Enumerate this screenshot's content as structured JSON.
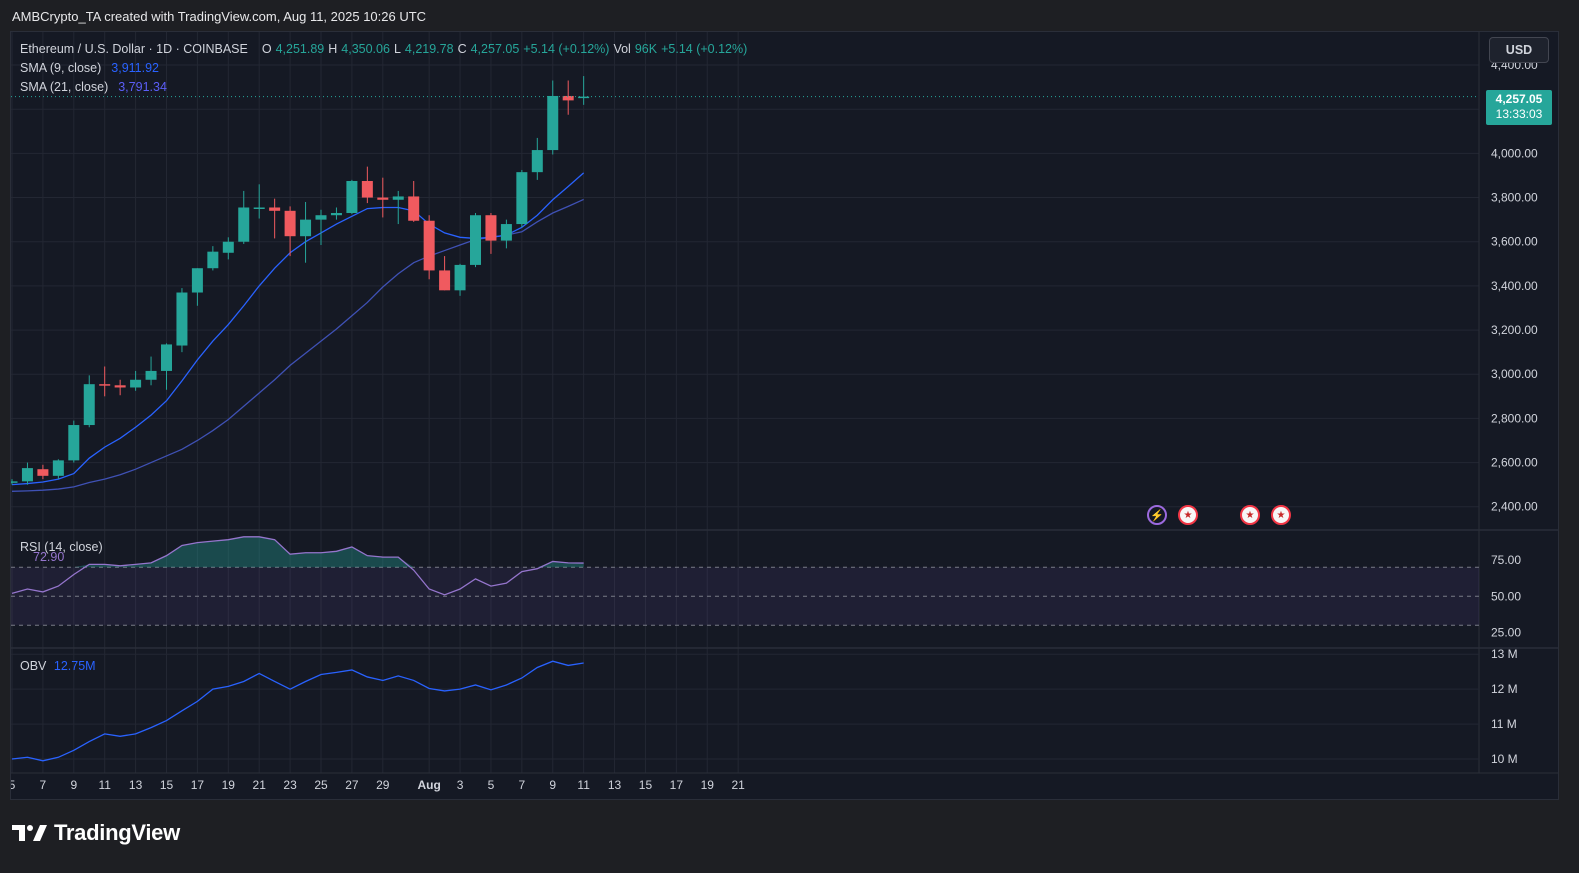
{
  "caption": "AMBCrypto_TA created with TradingView.com, Aug 11, 2025 10:26 UTC",
  "header": {
    "symbol": "Ethereum / U.S. Dollar · 1D · COINBASE",
    "o_label": "O",
    "o_value": "4,251.89",
    "h_label": "H",
    "h_value": "4,350.06",
    "l_label": "L",
    "l_value": "4,219.78",
    "c_label": "C",
    "c_value": "4,257.05",
    "change": "+5.14 (+0.12%)",
    "vol_label": "Vol",
    "vol_value": "96K",
    "vol_change": "+5.14 (+0.12%)"
  },
  "indicators": {
    "sma9_label": "SMA (9, close)",
    "sma9_value": "3,911.92",
    "sma21_label": "SMA (21, close)",
    "sma21_value": "3,791.34",
    "rsi_label": "RSI (14, close)",
    "rsi_value": "72.90",
    "obv_label": "OBV",
    "obv_value": "12.75M"
  },
  "toolbar": {
    "currency_label": "USD"
  },
  "last_price": {
    "price": "4,257.05",
    "countdown": "13:33:03"
  },
  "brand": {
    "name": "TradingView"
  },
  "colors": {
    "up": "#26a69a",
    "down": "#f05a5f",
    "sma9": "#2962ff",
    "sma21": "#3f51b5",
    "rsi": "#9575cd",
    "obv": "#2962ff",
    "background": "#151924",
    "grid": "#232733"
  },
  "icons": [
    "lightning-event-icon",
    "us-flag-event-icon",
    "us-flag-event-icon",
    "us-flag-event-icon"
  ],
  "chart_data": [
    {
      "type": "candlestick",
      "title": "Ethereum / U.S. Dollar · 1D · COINBASE",
      "x_tick_labels": [
        "5",
        "7",
        "9",
        "11",
        "13",
        "15",
        "17",
        "19",
        "21",
        "23",
        "25",
        "27",
        "29",
        "Aug",
        "3",
        "5",
        "7",
        "9",
        "11",
        "13",
        "15",
        "17",
        "19",
        "21"
      ],
      "y_tick_labels": [
        "4,400.00",
        "4,200.00",
        "4,000.00",
        "3,800.00",
        "3,600.00",
        "3,400.00",
        "3,200.00",
        "3,000.00",
        "2,800.00",
        "2,600.00",
        "2,400.00"
      ],
      "ylim": [
        2340,
        4450
      ],
      "grid": true,
      "dates": [
        "Jul 5",
        "Jul 6",
        "Jul 7",
        "Jul 8",
        "Jul 9",
        "Jul 10",
        "Jul 11",
        "Jul 12",
        "Jul 13",
        "Jul 14",
        "Jul 15",
        "Jul 16",
        "Jul 17",
        "Jul 18",
        "Jul 19",
        "Jul 20",
        "Jul 21",
        "Jul 22",
        "Jul 23",
        "Jul 24",
        "Jul 25",
        "Jul 26",
        "Jul 27",
        "Jul 28",
        "Jul 29",
        "Jul 30",
        "Jul 31",
        "Aug 1",
        "Aug 2",
        "Aug 3",
        "Aug 4",
        "Aug 5",
        "Aug 6",
        "Aug 7",
        "Aug 8",
        "Aug 9",
        "Aug 10",
        "Aug 11"
      ],
      "ohlc": [
        [
          2510,
          2525,
          2500,
          2515
        ],
        [
          2515,
          2600,
          2500,
          2575
        ],
        [
          2570,
          2590,
          2525,
          2540
        ],
        [
          2540,
          2615,
          2525,
          2610
        ],
        [
          2610,
          2790,
          2600,
          2770
        ],
        [
          2770,
          2995,
          2760,
          2955
        ],
        [
          2955,
          3035,
          2900,
          2950
        ],
        [
          2950,
          2975,
          2905,
          2940
        ],
        [
          2940,
          3015,
          2925,
          2975
        ],
        [
          2975,
          3080,
          2950,
          3015
        ],
        [
          3015,
          3140,
          2930,
          3135
        ],
        [
          3130,
          3390,
          3100,
          3370
        ],
        [
          3370,
          3480,
          3310,
          3480
        ],
        [
          3480,
          3580,
          3470,
          3555
        ],
        [
          3550,
          3620,
          3520,
          3600
        ],
        [
          3600,
          3830,
          3590,
          3755
        ],
        [
          3755,
          3860,
          3705,
          3755
        ],
        [
          3755,
          3795,
          3615,
          3740
        ],
        [
          3740,
          3760,
          3535,
          3625
        ],
        [
          3625,
          3780,
          3505,
          3700
        ],
        [
          3700,
          3745,
          3585,
          3720
        ],
        [
          3720,
          3755,
          3700,
          3730
        ],
        [
          3730,
          3880,
          3725,
          3875
        ],
        [
          3875,
          3940,
          3775,
          3800
        ],
        [
          3800,
          3890,
          3710,
          3790
        ],
        [
          3790,
          3830,
          3680,
          3805
        ],
        [
          3805,
          3875,
          3690,
          3695
        ],
        [
          3695,
          3720,
          3430,
          3470
        ],
        [
          3470,
          3535,
          3380,
          3380
        ],
        [
          3380,
          3500,
          3355,
          3495
        ],
        [
          3495,
          3730,
          3485,
          3720
        ],
        [
          3720,
          3730,
          3545,
          3605
        ],
        [
          3605,
          3700,
          3570,
          3680
        ],
        [
          3680,
          3925,
          3665,
          3915
        ],
        [
          3915,
          4070,
          3880,
          4015
        ],
        [
          4015,
          4330,
          3995,
          4260
        ],
        [
          4260,
          4330,
          4175,
          4240
        ],
        [
          4251.89,
          4350.06,
          4219.78,
          4257.05
        ]
      ],
      "series": [
        {
          "name": "SMA (9, close)",
          "values": [
            2500,
            2505,
            2512,
            2525,
            2550,
            2620,
            2670,
            2710,
            2760,
            2815,
            2880,
            2970,
            3065,
            3150,
            3225,
            3310,
            3400,
            3480,
            3550,
            3600,
            3640,
            3680,
            3715,
            3750,
            3755,
            3755,
            3740,
            3680,
            3640,
            3620,
            3615,
            3620,
            3630,
            3665,
            3720,
            3790,
            3850,
            3911.92
          ]
        },
        {
          "name": "SMA (21, close)",
          "values": [
            2470,
            2472,
            2475,
            2480,
            2490,
            2510,
            2525,
            2545,
            2570,
            2600,
            2630,
            2660,
            2700,
            2745,
            2795,
            2855,
            2915,
            2975,
            3040,
            3095,
            3150,
            3205,
            3265,
            3325,
            3395,
            3455,
            3505,
            3535,
            3560,
            3585,
            3610,
            3620,
            3630,
            3645,
            3690,
            3730,
            3760,
            3791.34
          ]
        }
      ]
    },
    {
      "type": "line",
      "title": "RSI (14, close)",
      "y_tick_labels": [
        "75.00",
        "50.00",
        "25.00"
      ],
      "ylim": [
        15,
        95
      ],
      "bands": [
        30,
        70
      ],
      "midline": 50,
      "series": [
        {
          "name": "RSI (14, close)",
          "values": [
            52,
            55,
            53,
            57,
            65,
            72,
            72,
            71,
            72,
            73,
            78,
            85,
            87,
            88,
            89,
            91,
            91,
            89,
            79,
            80,
            80,
            81,
            84,
            78,
            77,
            77,
            68,
            55,
            51,
            55,
            62,
            57,
            59,
            67,
            69,
            74,
            73,
            72.9
          ]
        }
      ]
    },
    {
      "type": "line",
      "title": "OBV",
      "y_tick_labels": [
        "13 M",
        "12 M",
        "11 M",
        "10 M"
      ],
      "ylim": [
        9.6,
        13.15
      ],
      "series": [
        {
          "name": "OBV",
          "values": [
            10.0,
            10.05,
            9.95,
            10.05,
            10.25,
            10.5,
            10.72,
            10.65,
            10.72,
            10.9,
            11.1,
            11.38,
            11.65,
            12.0,
            12.08,
            12.22,
            12.45,
            12.22,
            12.0,
            12.22,
            12.42,
            12.48,
            12.55,
            12.35,
            12.25,
            12.38,
            12.25,
            12.02,
            11.95,
            12.0,
            12.12,
            11.98,
            12.12,
            12.32,
            12.62,
            12.8,
            12.68,
            12.75
          ]
        }
      ]
    }
  ]
}
